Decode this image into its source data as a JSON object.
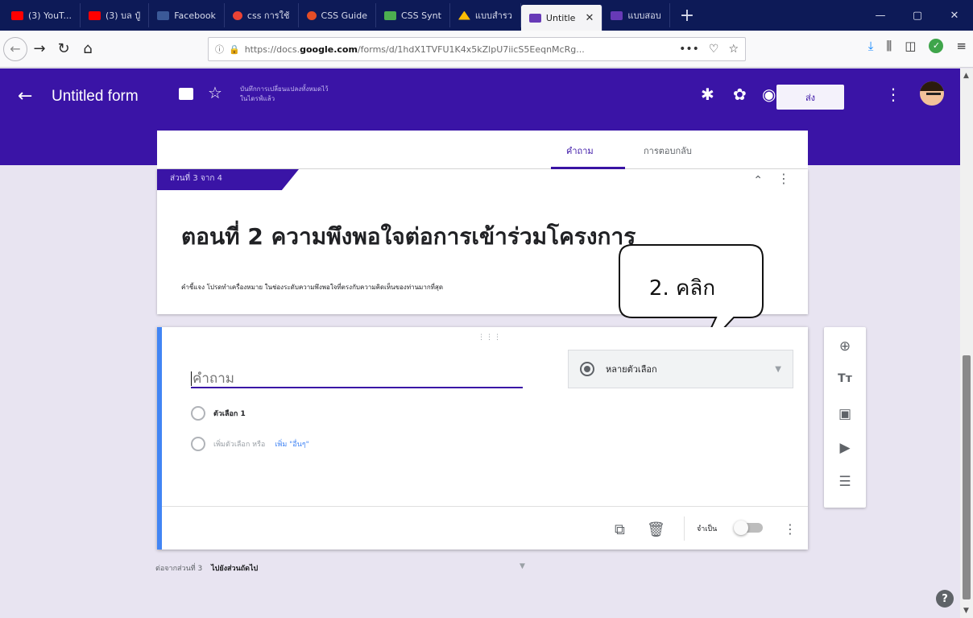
{
  "browser": {
    "tabs": [
      {
        "label": "(3) YouT...",
        "color": "#ff0000"
      },
      {
        "label": "(3) บล ปู๋",
        "color": "#ff0000"
      },
      {
        "label": "Facebook",
        "color": "#3b5998"
      },
      {
        "label": "css การใช้",
        "color": "#ea4335"
      },
      {
        "label": "CSS Guide",
        "color": "#e44d26"
      },
      {
        "label": "CSS Synt",
        "color": "#4caf50"
      },
      {
        "label": "แบบสำรว",
        "color": "#fbbc04"
      },
      {
        "label": "Untitle",
        "color": "#673ab7",
        "active": true
      },
      {
        "label": "แบบสอบ",
        "color": "#673ab7"
      }
    ],
    "url_prefix": "https://docs.",
    "url_domain": "google.com",
    "url_rest": "/forms/d/1hdX1TVFU1K4x5kZlpU7iicS5EeqnMcRg..."
  },
  "form": {
    "title": "Untitled form",
    "save_note": "บันทึกการเปลี่ยนแปลงทั้งหมดไว้ในไดรฟ์แล้ว",
    "send_label": "ส่ง",
    "tab_questions": "คำถาม",
    "tab_responses": "การตอบกลับ",
    "section_badge": "ส่วนที่ 3 จาก 4",
    "section_title": "ตอนที่ 2 ความพึงพอใจต่อการเข้าร่วมโครงการ",
    "section_desc": "คำชี้แจง โปรดทำเครื่องหมาย ในช่องระดับความพึงพอใจที่ตรงกับความคิดเห็นของท่านมากที่สุด",
    "question_placeholder": "คำถาม",
    "question_type": "หลายตัวเลือก",
    "option1": "ตัวเลือก 1",
    "add_option": "เพิ่มตัวเลือก หรือ",
    "add_other": "เพิ่ม \"อื่นๆ\"",
    "required_label": "จำเป็น",
    "after_section": "ต่อจากส่วนที่ 3",
    "after_target": "ไปยังส่วนถัดไป"
  },
  "callout": {
    "text": "2. คลิก"
  },
  "colors": {
    "brand": "#3a14a6",
    "accent": "#4285f4",
    "page_bg": "#e8e4f1"
  }
}
